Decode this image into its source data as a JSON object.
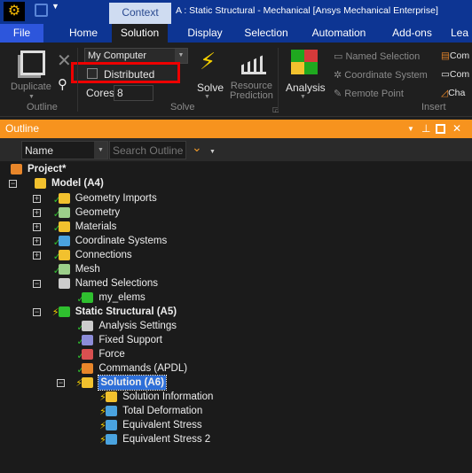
{
  "title": "A : Static Structural - Mechanical [Ansys Mechanical Enterprise]",
  "context_tab": "Context",
  "tabs": [
    {
      "label": "File"
    },
    {
      "label": "Home"
    },
    {
      "label": "Solution",
      "active": true
    },
    {
      "label": "Display"
    },
    {
      "label": "Selection"
    },
    {
      "label": "Automation"
    },
    {
      "label": "Add-ons"
    },
    {
      "label": "Lea"
    }
  ],
  "ribbon": {
    "duplicate": "Duplicate",
    "outline_group": "Outline",
    "solver_target": "My Computer",
    "distributed": "Distributed",
    "distributed_checked": false,
    "cores_label": "Cores",
    "cores_value": "8",
    "solve": "Solve",
    "resource_prediction_1": "Resource",
    "resource_prediction_2": "Prediction",
    "solve_group": "Solve",
    "analysis": "Analysis",
    "named_selection": "Named Selection",
    "coordinate_system": "Coordinate System",
    "remote_point": "Remote Point",
    "com1": "Com",
    "com2": "Com",
    "cha": "Cha",
    "insert_group": "Insert"
  },
  "outline": {
    "title": "Outline",
    "filter": "Name",
    "search_placeholder": "Search Outline",
    "tree": [
      {
        "label": "Project*",
        "level": 0,
        "bold": true,
        "icon": "project-icon",
        "color": "#e8862a"
      },
      {
        "label": "Model (A4)",
        "level": 1,
        "bold": true,
        "expander": "-",
        "icon": "model-icon",
        "color": "#f2c12e"
      },
      {
        "label": "Geometry Imports",
        "level": 2,
        "expander": "+",
        "status": "check",
        "icon": "geometry-imports-icon",
        "color": "#f2c12e"
      },
      {
        "label": "Geometry",
        "level": 2,
        "expander": "+",
        "status": "check",
        "icon": "geometry-icon",
        "color": "#9ccf8a"
      },
      {
        "label": "Materials",
        "level": 2,
        "expander": "+",
        "status": "check",
        "icon": "materials-icon",
        "color": "#f2c12e"
      },
      {
        "label": "Coordinate Systems",
        "level": 2,
        "expander": "+",
        "status": "check",
        "icon": "coordinate-systems-icon",
        "color": "#4aa3df"
      },
      {
        "label": "Connections",
        "level": 2,
        "expander": "+",
        "status": "check",
        "icon": "connections-icon",
        "color": "#f2c12e"
      },
      {
        "label": "Mesh",
        "level": 2,
        "status": "check",
        "icon": "mesh-icon",
        "color": "#9ccf8a"
      },
      {
        "label": "Named Selections",
        "level": 2,
        "expander": "-",
        "icon": "named-selections-icon",
        "color": "#cccccc"
      },
      {
        "label": "my_elems",
        "level": 3,
        "status": "check",
        "icon": "named-selection-icon",
        "color": "#2fbf2f"
      },
      {
        "label": "Static Structural (A5)",
        "level": 2,
        "bold": true,
        "expander": "-",
        "status": "bolt",
        "icon": "static-structural-icon",
        "color": "#2fbf2f"
      },
      {
        "label": "Analysis Settings",
        "level": 3,
        "status": "check",
        "icon": "analysis-settings-icon",
        "color": "#cccccc"
      },
      {
        "label": "Fixed Support",
        "level": 3,
        "status": "check",
        "icon": "fixed-support-icon",
        "color": "#8c8cd8"
      },
      {
        "label": "Force",
        "level": 3,
        "status": "check",
        "icon": "force-icon",
        "color": "#d85050"
      },
      {
        "label": "Commands (APDL)",
        "level": 3,
        "status": "check",
        "icon": "commands-icon",
        "color": "#e8862a"
      },
      {
        "label": "Solution (A6)",
        "level": 3,
        "bold": true,
        "selected": true,
        "expander": "-",
        "status": "bolt",
        "icon": "solution-icon",
        "color": "#f2c12e"
      },
      {
        "label": "Solution Information",
        "level": 4,
        "status": "bolt",
        "icon": "solution-information-icon",
        "color": "#f2c12e"
      },
      {
        "label": "Total Deformation",
        "level": 4,
        "status": "bolt",
        "icon": "total-deformation-icon",
        "color": "#4aa3df"
      },
      {
        "label": "Equivalent Stress",
        "level": 4,
        "status": "bolt",
        "icon": "equivalent-stress-icon",
        "color": "#4aa3df"
      },
      {
        "label": "Equivalent Stress 2",
        "level": 4,
        "status": "bolt",
        "icon": "equivalent-stress-icon",
        "color": "#4aa3df"
      }
    ]
  }
}
